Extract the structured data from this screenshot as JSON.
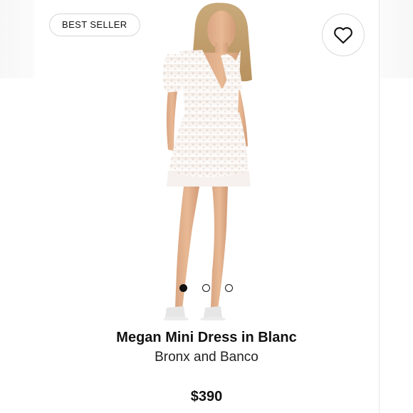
{
  "badge": {
    "label": "BEST SELLER"
  },
  "favorite": {
    "icon": "heart-icon"
  },
  "carousel": {
    "total": 3,
    "active_index": 0
  },
  "product": {
    "title": "Megan Mini Dress in Blanc",
    "brand": "Bronx and Banco",
    "price": "$390"
  },
  "colors": {
    "text": "#111111",
    "border": "#d6d6d6",
    "background": "#ffffff"
  }
}
